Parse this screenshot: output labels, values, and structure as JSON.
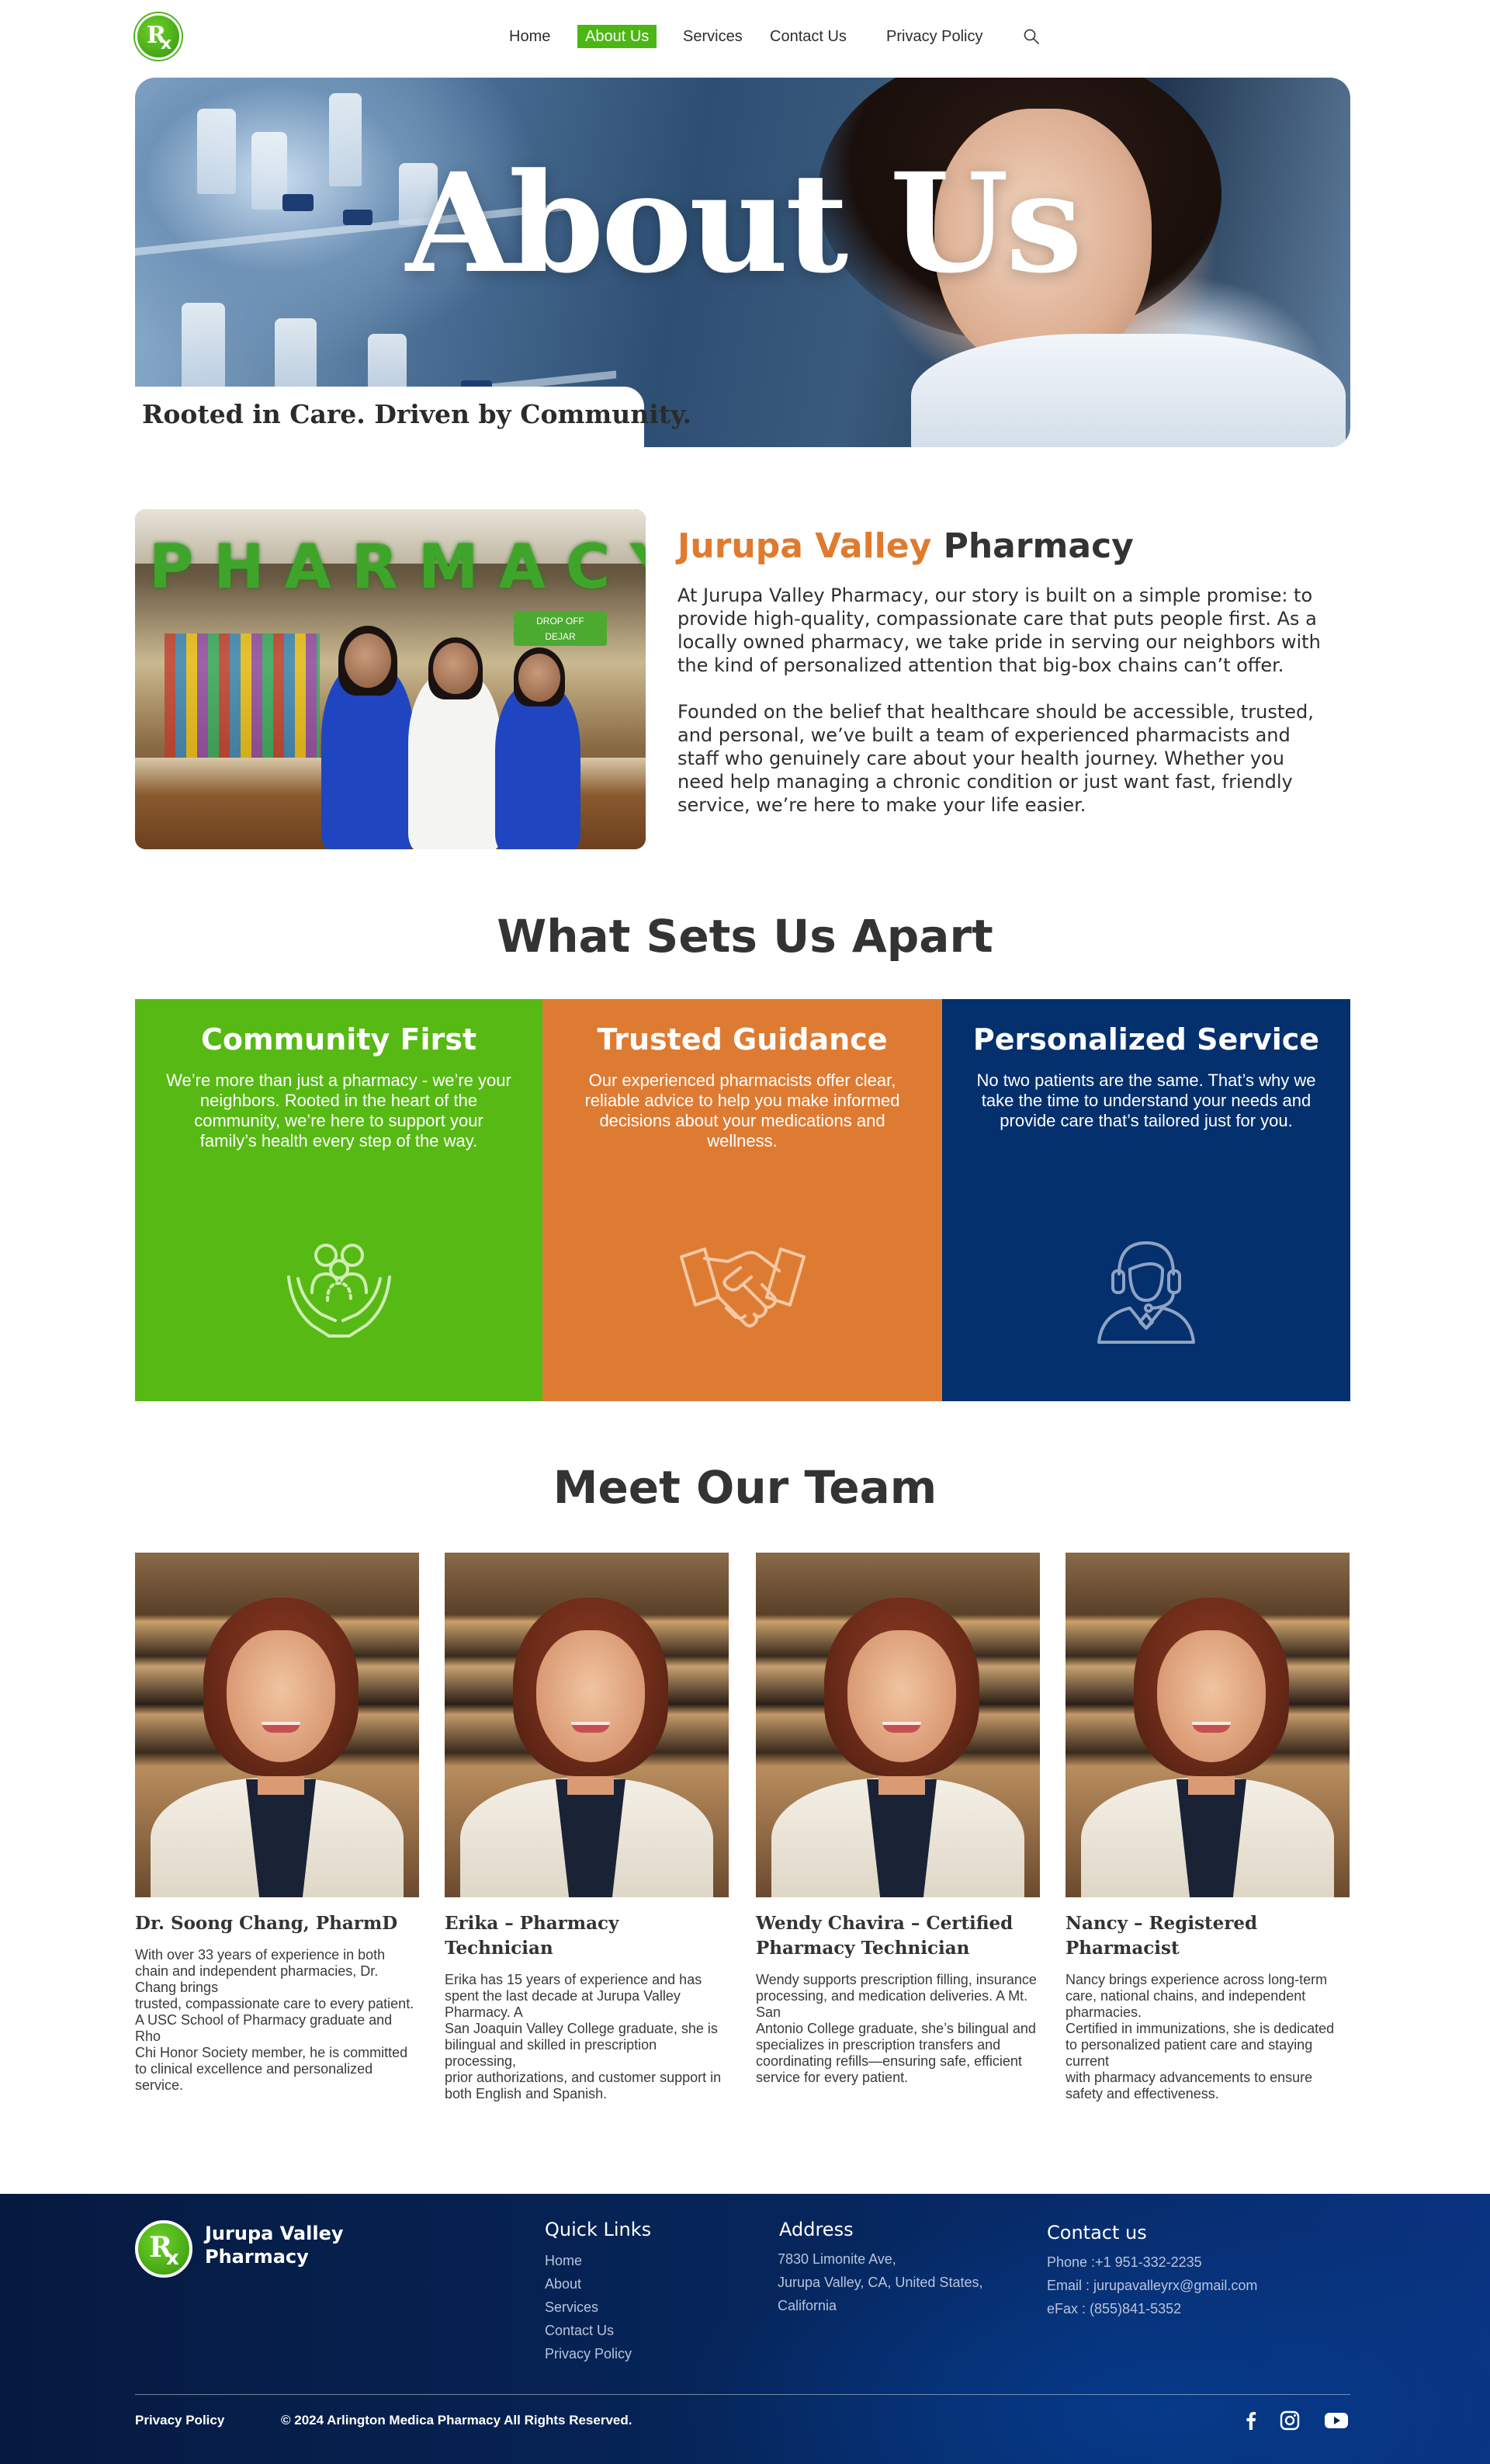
{
  "nav": {
    "items": [
      {
        "label": "Home",
        "active": false
      },
      {
        "label": "About Us",
        "active": true
      },
      {
        "label": "Services",
        "active": false
      },
      {
        "label": "Contact Us",
        "active": false
      },
      {
        "label": "Privacy Policy",
        "active": false
      }
    ],
    "search_icon": "search-icon",
    "logo_text": [
      "R",
      "x"
    ]
  },
  "hero": {
    "title": "About Us",
    "tagline": "Rooted in Care. Driven by Community."
  },
  "about": {
    "photo_sign": "PHARMACY",
    "photo_drop_label": [
      "DROP OFF",
      "DEJAR"
    ],
    "heading_accent": "Jurupa Valley",
    "heading_rest": "Pharmacy",
    "paragraph_1": "At Jurupa Valley Pharmacy, our story is built on a simple promise: to provide high-quality, compassionate care that puts people first. As a locally owned pharmacy, we take pride in serving our neighbors with the kind of personalized attention that big-box chains can’t offer.",
    "paragraph_2": "Founded on the belief that healthcare should be accessible, trusted, and personal, we’ve built a team of experienced pharmacists and staff who genuinely care about your health journey. Whether you need help managing a chronic condition or just want fast, friendly service, we’re here to make your life easier."
  },
  "features": {
    "title": "What Sets Us Apart",
    "items": [
      {
        "title": "Community First",
        "text": "We’re more than just a pharmacy - we’re your neighbors. Rooted in the heart of the community, we’re here to support your family’s health every step of the way.",
        "color": "#57b914",
        "icon": "community-hands-icon"
      },
      {
        "title": "Trusted Guidance",
        "text": "Our experienced pharmacists offer clear, reliable advice to help you make informed decisions about your medications and wellness.",
        "color": "#de7b33",
        "icon": "handshake-icon"
      },
      {
        "title": "Personalized Service",
        "text": "No two patients are the same. That’s why we take the time to understand your needs and provide care that’s tailored just for you.",
        "color": "#04306d",
        "icon": "support-agent-icon"
      }
    ]
  },
  "team": {
    "title": "Meet Our Team",
    "members": [
      {
        "name": "Dr. Soong Chang, PharmD",
        "bio": [
          "With over 33 years of experience in both chain and independent pharmacies, Dr. Chang brings",
          "trusted, compassionate care to every patient.  A USC School of Pharmacy graduate and Rho",
          "Chi Honor Society member, he is committed to clinical excellence and personalized service."
        ]
      },
      {
        "name": "Erika – Pharmacy Technician",
        "bio": [
          "Erika has 15 years of experience and has spent the last decade at Jurupa Valley Pharmacy. A",
          "San Joaquin Valley College graduate, she is bilingual and skilled in prescription processing,",
          "prior authorizations, and customer support in both English and Spanish."
        ]
      },
      {
        "name": "Wendy Chavira – Certified Pharmacy Technician",
        "bio": [
          "Wendy supports prescription filling, insurance processing, and medication deliveries. A Mt. San",
          "Antonio College graduate, she’s bilingual and specializes in prescription transfers and",
          "coordinating refills—ensuring safe, efficient service for every patient."
        ]
      },
      {
        "name": "Nancy – Registered Pharmacist",
        "bio": [
          "Nancy brings experience across long-term care, national chains, and independent pharmacies.",
          "Certified in immunizations, she is dedicated to personalized patient care and staying current",
          "with pharmacy advancements to ensure safety and effectiveness."
        ]
      }
    ]
  },
  "footer": {
    "brand": [
      "Jurupa Valley",
      "Pharmacy"
    ],
    "quick_links_title": "Quick Links",
    "quick_links": [
      "Home",
      "About",
      "Services",
      "Contact Us",
      "Privacy Policy"
    ],
    "address_title": "Address",
    "address_lines": [
      "7830 Limonite Ave,",
      "Jurupa Valley, CA, United States,",
      "California"
    ],
    "contact_title": "Contact us",
    "contact_lines": [
      "Phone :+1 951-332-2235",
      "Email : jurupavalleyrx@gmail.com",
      "eFax : (855)841-5352"
    ],
    "privacy": "Privacy Policy",
    "copyright": "© 2024 Arlington Medica Pharmacy All Rights Reserved.",
    "social_icons": [
      "facebook-icon",
      "instagram-icon",
      "youtube-icon"
    ]
  }
}
